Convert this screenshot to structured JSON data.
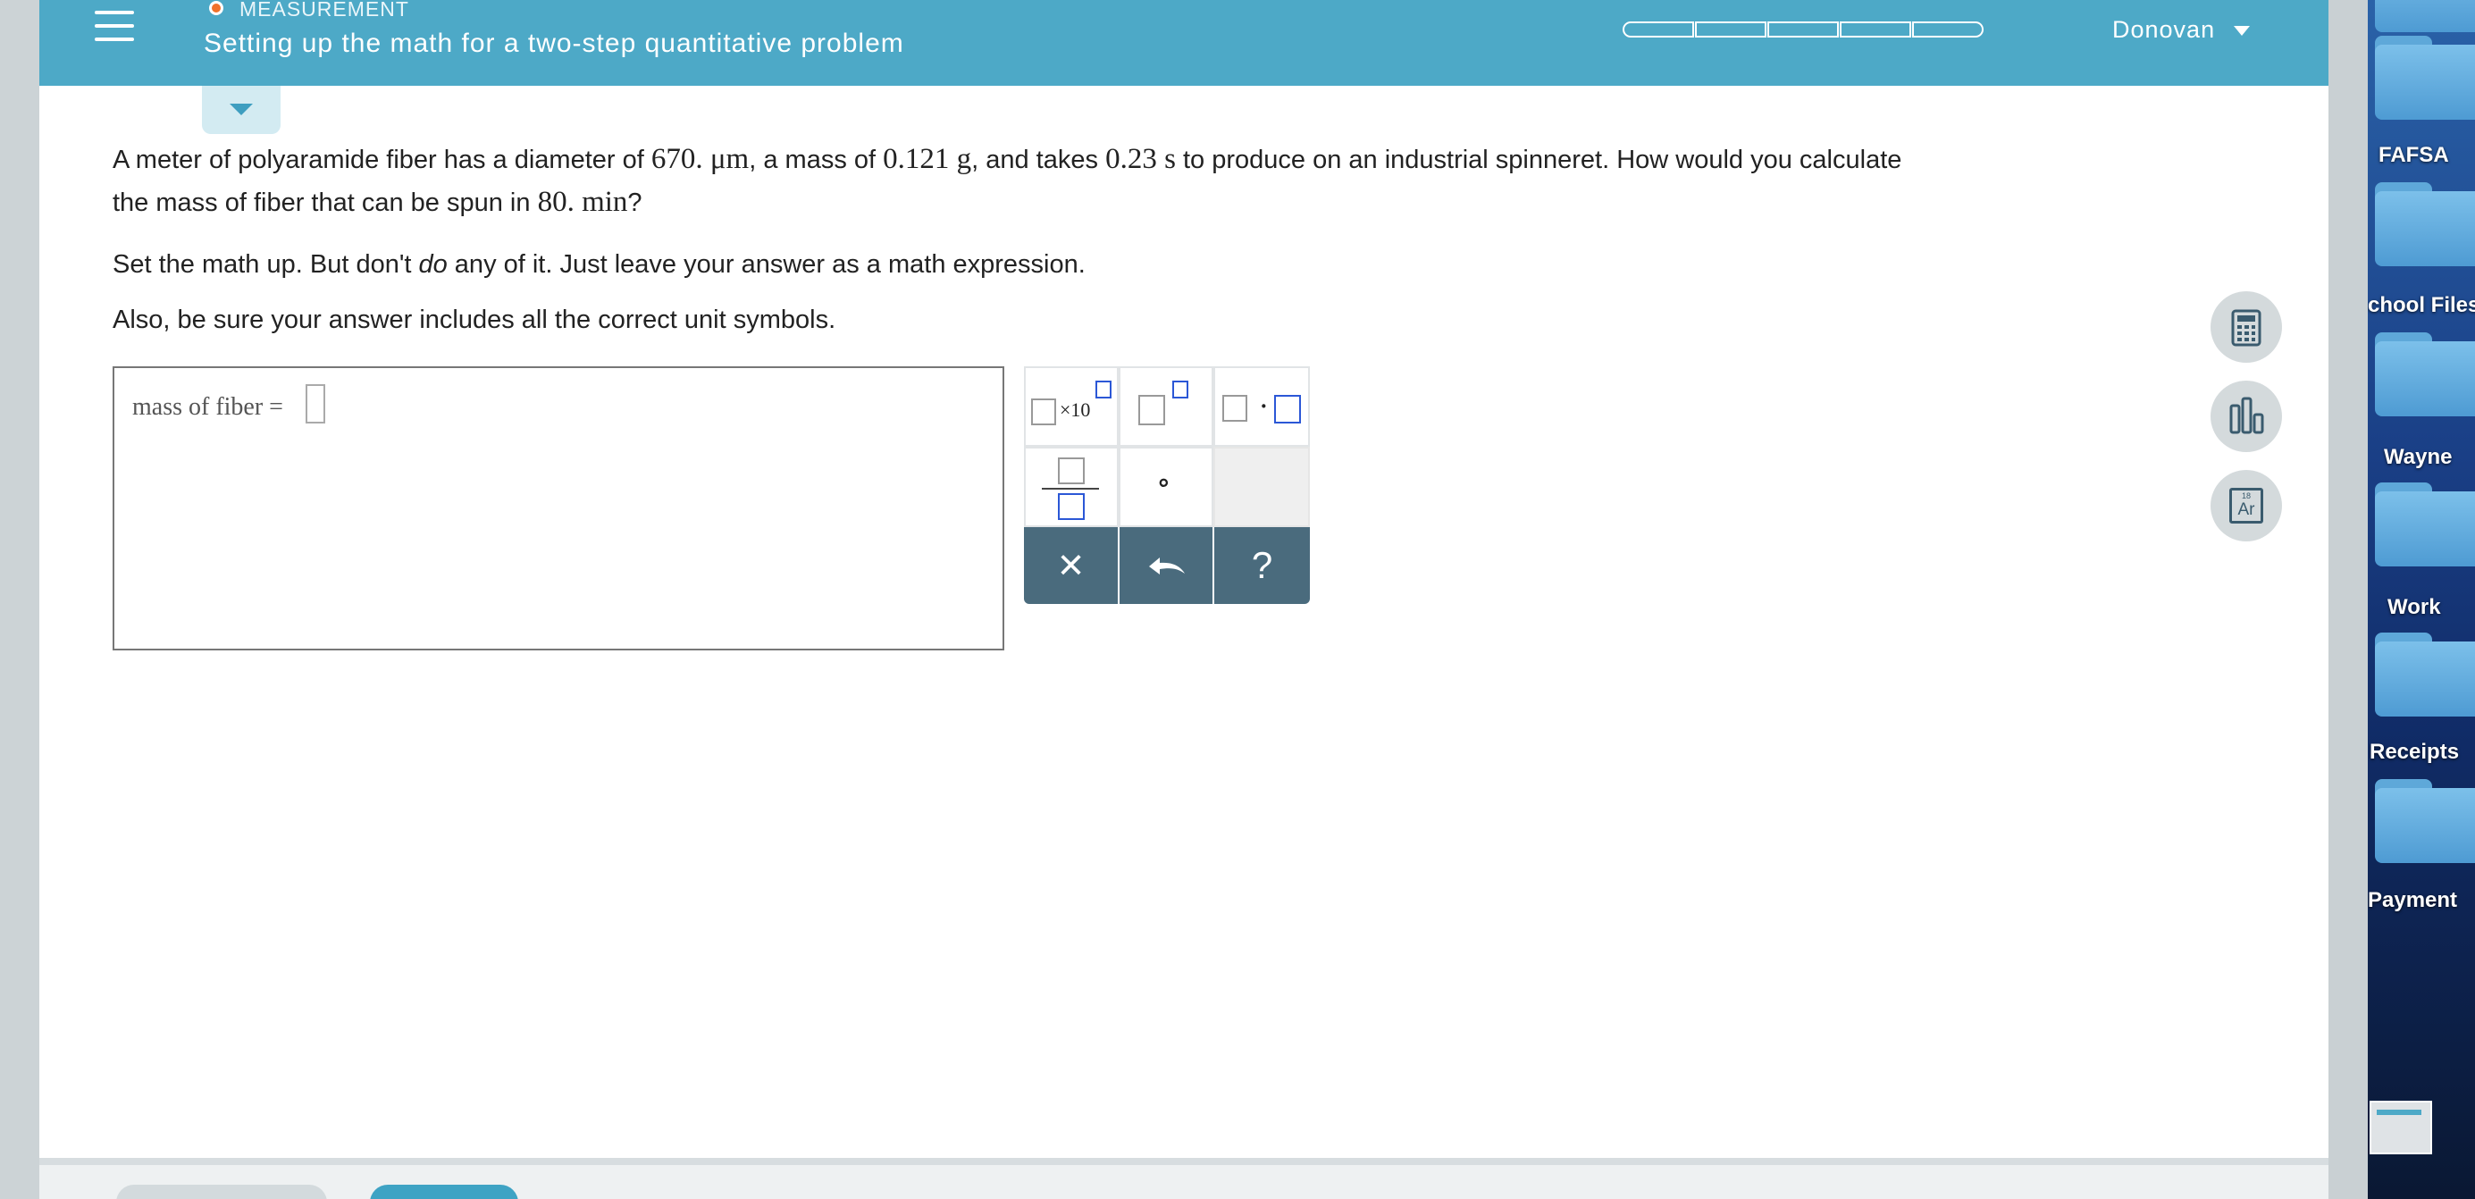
{
  "header": {
    "topic": "MEASUREMENT",
    "title": "Setting up the math for a two-step quantitative problem",
    "user": "Donovan",
    "progress_segments": 5,
    "accent_color": "#4da9c7",
    "topic_dot_color": "#f0712b"
  },
  "question": {
    "line1": {
      "t1": "A meter of polyaramide fiber has a diameter of ",
      "m1": "670. μm",
      "t2": ", a mass of ",
      "m2": "0.121 g",
      "t3": ", and takes ",
      "m3": "0.23 s",
      "t4": " to produce on an industrial spinneret. How would you calculate"
    },
    "line2": {
      "t1": "the mass of fiber that can be spun in ",
      "m1": "80. min",
      "t2": "?"
    },
    "instruction1": {
      "before": "Set the math up. But don't ",
      "emph": "do",
      "after": " any of it. Just leave your answer as a math expression."
    },
    "instruction2": "Also, be sure your answer includes all the correct unit symbols."
  },
  "answer": {
    "label": "mass of fiber =",
    "value": ""
  },
  "palette": {
    "sci_label": "×10",
    "degree_symbol": "∘",
    "dot_symbol": "·",
    "clear_symbol": "✕",
    "help_symbol": "?"
  },
  "tools": {
    "periodic_number": "18",
    "periodic_symbol": "Ar"
  },
  "desktop": {
    "folders": [
      "FAFSA",
      "chool Files",
      "Wayne",
      "Work",
      "Receipts",
      "Payment"
    ]
  }
}
